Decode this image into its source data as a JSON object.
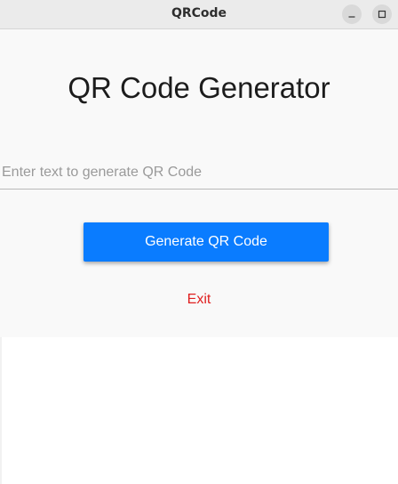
{
  "window": {
    "title": "QRCode",
    "controls": {
      "minimize_icon": "minimize-icon",
      "maximize_icon": "maximize-icon"
    }
  },
  "main": {
    "heading": "QR Code Generator",
    "input": {
      "value": "",
      "placeholder": "Enter text to generate QR Code"
    },
    "generate_button_label": "Generate QR Code",
    "exit_label": "Exit"
  },
  "colors": {
    "accent": "#0a7cff",
    "exit": "#e02020",
    "background": "#f9f9f9",
    "titlebar": "#ebebeb"
  }
}
